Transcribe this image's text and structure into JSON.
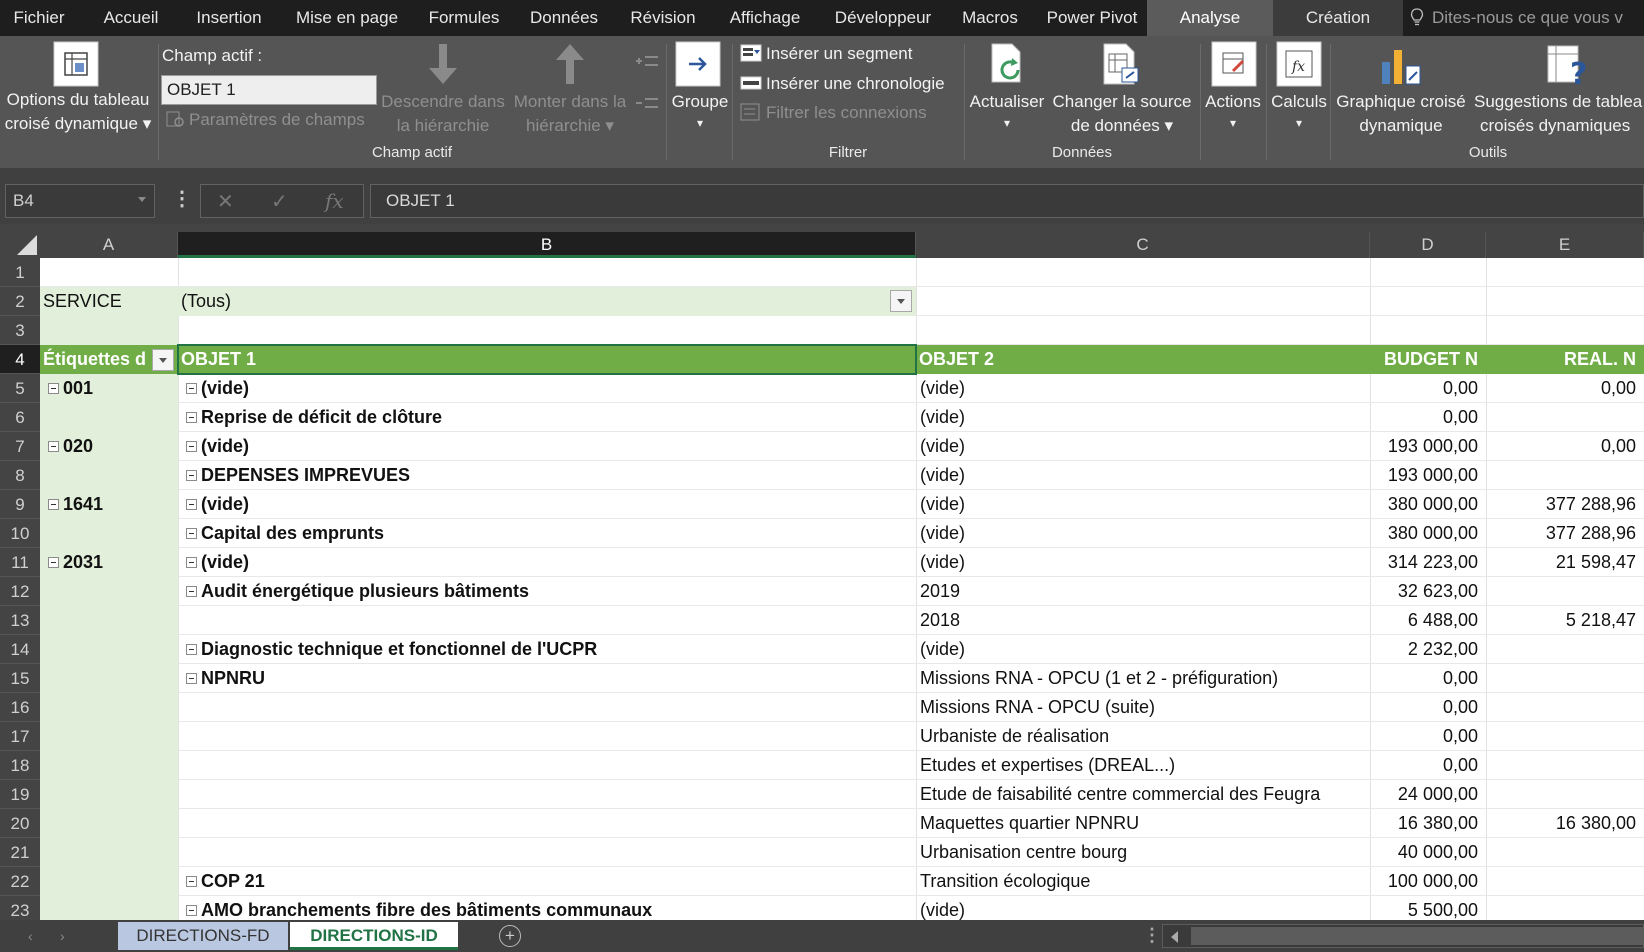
{
  "menu": {
    "tabs": [
      "Fichier",
      "Accueil",
      "Insertion",
      "Mise en page",
      "Formules",
      "Données",
      "Révision",
      "Affichage",
      "Développeur",
      "Macros",
      "Power Pivot",
      "Analyse",
      "Création"
    ],
    "active": "Analyse",
    "tell_me": "Dites-nous ce que vous v"
  },
  "ribbon": {
    "options": {
      "line1": "Options du tableau",
      "line2": "croisé dynamique"
    },
    "champ_actif": {
      "label": "Champ actif :",
      "value": "OBJET 1",
      "params": "Paramètres de champs",
      "drill_down": {
        "line1": "Descendre dans",
        "line2": "la hiérarchie"
      },
      "drill_up": {
        "line1": "Monter dans la",
        "line2": "hiérarchie"
      },
      "group_title": "Champ actif"
    },
    "groupe": "Groupe",
    "filtrer": {
      "segment": "Insérer un segment",
      "chronologie": "Insérer une chronologie",
      "connexions": "Filtrer les connexions",
      "group_title": "Filtrer"
    },
    "donnees": {
      "actualiser": "Actualiser",
      "source": {
        "line1": "Changer la source",
        "line2": "de données"
      },
      "group_title": "Données"
    },
    "actions": "Actions",
    "calculs": "Calculs",
    "outils": {
      "graphique": {
        "line1": "Graphique croisé",
        "line2": "dynamique"
      },
      "suggestions": {
        "line1": "Suggestions de tablea",
        "line2": "croisés dynamiques"
      },
      "group_title": "Outils"
    }
  },
  "formula_bar": {
    "name_box": "B4",
    "cancel": "✕",
    "enter": "✓",
    "fx": "fx",
    "content": "OBJET 1"
  },
  "sheet": {
    "columns": [
      "A",
      "B",
      "C",
      "D",
      "E"
    ],
    "row_numbers": [
      "1",
      "2",
      "3",
      "4",
      "5",
      "6",
      "7",
      "8",
      "9",
      "10",
      "11",
      "12",
      "13",
      "14",
      "15",
      "16",
      "17",
      "18",
      "19",
      "20",
      "21",
      "22",
      "23"
    ],
    "filter_row": {
      "label": "SERVICE",
      "value": "(Tous)"
    },
    "header_row": {
      "a": "Étiquettes d",
      "b": "OBJET 1",
      "c": "OBJET 2",
      "d": "BUDGET N",
      "e": "REAL. N"
    },
    "rows": [
      {
        "a": "001",
        "b": "(vide)",
        "c": "(vide)",
        "d": "0,00",
        "e": "0,00"
      },
      {
        "a": "",
        "b": "Reprise de déficit de clôture",
        "c": "(vide)",
        "d": "0,00",
        "e": ""
      },
      {
        "a": "020",
        "b": "(vide)",
        "c": "(vide)",
        "d": "193 000,00",
        "e": "0,00"
      },
      {
        "a": "",
        "b": "DEPENSES IMPREVUES",
        "c": "(vide)",
        "d": "193 000,00",
        "e": ""
      },
      {
        "a": "1641",
        "b": "(vide)",
        "c": "(vide)",
        "d": "380 000,00",
        "e": "377 288,96"
      },
      {
        "a": "",
        "b": "Capital des emprunts",
        "c": "(vide)",
        "d": "380 000,00",
        "e": "377 288,96"
      },
      {
        "a": "2031",
        "b": "(vide)",
        "c": "(vide)",
        "d": "314 223,00",
        "e": "21 598,47"
      },
      {
        "a": "",
        "b": "Audit énergétique plusieurs bâtiments",
        "c": "2019",
        "d": "32 623,00",
        "e": ""
      },
      {
        "a": "",
        "b": "",
        "c": "2018",
        "d": "6 488,00",
        "e": "5 218,47"
      },
      {
        "a": "",
        "b": "Diagnostic technique et fonctionnel de l'UCPR",
        "c": "(vide)",
        "d": "2 232,00",
        "e": ""
      },
      {
        "a": "",
        "b": "NPNRU",
        "c": "Missions RNA - OPCU (1 et 2 - préfiguration)",
        "d": "0,00",
        "e": ""
      },
      {
        "a": "",
        "b": "",
        "c": "Missions RNA - OPCU (suite)",
        "d": "0,00",
        "e": ""
      },
      {
        "a": "",
        "b": "",
        "c": "Urbaniste de réalisation",
        "d": "0,00",
        "e": ""
      },
      {
        "a": "",
        "b": "",
        "c": "Etudes et expertises (DREAL...)",
        "d": "0,00",
        "e": ""
      },
      {
        "a": "",
        "b": "",
        "c": "Etude de faisabilité centre commercial des Feugra",
        "d": "24 000,00",
        "e": ""
      },
      {
        "a": "",
        "b": "",
        "c": "Maquettes quartier NPNRU",
        "d": "16 380,00",
        "e": "16 380,00"
      },
      {
        "a": "",
        "b": "",
        "c": "Urbanisation centre bourg",
        "d": "40 000,00",
        "e": ""
      },
      {
        "a": "",
        "b": "COP 21",
        "c": "Transition écologique",
        "d": "100 000,00",
        "e": ""
      },
      {
        "a": "",
        "b": "AMO branchements fibre des bâtiments communaux",
        "c": "(vide)",
        "d": "5 500,00",
        "e": ""
      }
    ]
  },
  "sheet_tabs": [
    "DIRECTIONS-FD",
    "DIRECTIONS-ID"
  ],
  "active_sheet": "DIRECTIONS-ID",
  "colors": {
    "header_green": "#70ad47",
    "label_col_green": "#e2efda",
    "active_tab_text": "#217346"
  }
}
